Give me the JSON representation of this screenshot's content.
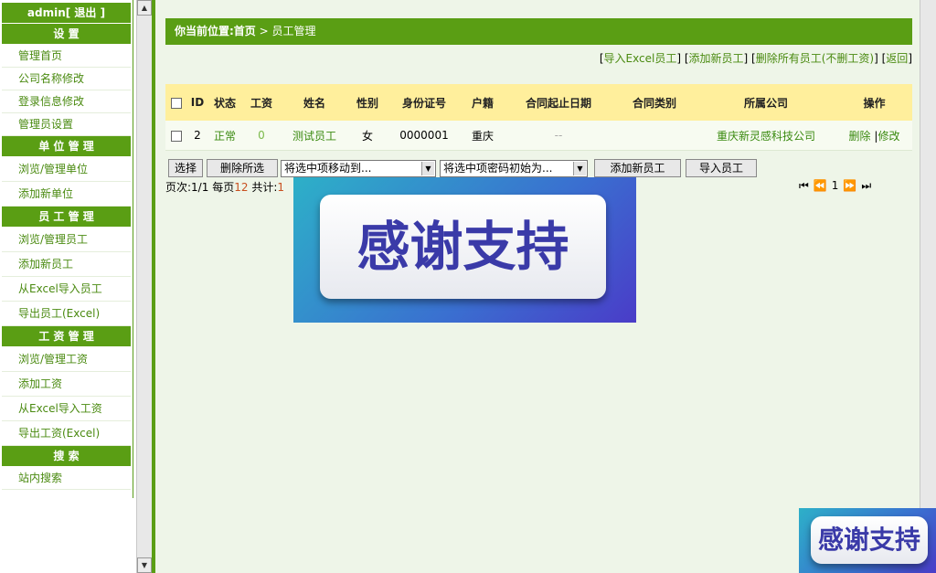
{
  "sidebar": {
    "user_label": "admin[ 退出 ]",
    "sections": [
      {
        "title": "设    置",
        "items": [
          "管理首页",
          "公司名称修改",
          "登录信息修改",
          "管理员设置"
        ]
      },
      {
        "title": "单 位 管 理",
        "items": [
          "浏览/管理单位",
          "添加新单位"
        ]
      },
      {
        "title": "员 工 管 理",
        "items": [
          "浏览/管理员工",
          "添加新员工",
          "从Excel导入员工",
          "导出员工(Excel)"
        ]
      },
      {
        "title": "工 资 管 理",
        "items": [
          "浏览/管理工资",
          "添加工资",
          "从Excel导入工资",
          "导出工资(Excel)"
        ]
      },
      {
        "title": "搜    索",
        "items": [
          "站内搜索"
        ]
      }
    ]
  },
  "breadcrumb": {
    "label": "你当前位置:首页",
    "sep": " > ",
    "current": "员工管理"
  },
  "toplinks": [
    "导入Excel员工",
    "添加新员工",
    "删除所有员工(不删工资)",
    "返回"
  ],
  "table": {
    "headers": [
      "ID",
      "状态",
      "工资",
      "姓名",
      "性别",
      "身份证号",
      "户籍",
      "合同起止日期",
      "合同类别",
      "所属公司",
      "操作"
    ],
    "rows": [
      {
        "id": "2",
        "status": "正常",
        "salary": "0",
        "name": "测试员工",
        "gender": "女",
        "idcard": "0000001",
        "huji": "重庆",
        "dates": "--",
        "ctype": "",
        "company": "重庆新灵感科技公司",
        "op_delete": "删除",
        "op_sep": "|",
        "op_edit": "修改"
      }
    ]
  },
  "actions": {
    "select_btn": "选择",
    "delete_btn": "删除所选",
    "move_select": "将选中项移动到...",
    "pwd_select": "将选中项密码初始为...",
    "add_btn": "添加新员工",
    "import_btn": "导入员工"
  },
  "pageinfo": {
    "p1": "页次:",
    "page": "1/1",
    "p2": "每页",
    "perpage": "12",
    "p3": "共计:",
    "total": "1"
  },
  "pager": {
    "first": "⏮",
    "prev": "⏪",
    "current": "1",
    "next": "⏩",
    "last": "⏭"
  },
  "banner_text": "感谢支持"
}
